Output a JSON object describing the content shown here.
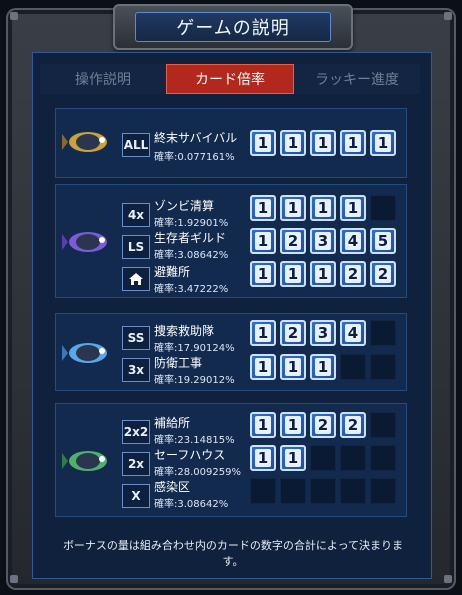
{
  "window": {
    "title": "ゲームの説明"
  },
  "tabs": [
    "操作説明",
    "カード倍率",
    "ラッキー進度"
  ],
  "active_tab": 1,
  "footer_text": "ボーナスの量は組み合わせ内のカードの数字の合計によって決まります。",
  "sections": [
    {
      "rows": [
        {
          "badge": "ALL",
          "name": "終末サバイバル",
          "prob": "確率:0.077161%",
          "cards": [
            "1",
            "1",
            "1",
            "1",
            "1"
          ]
        }
      ]
    },
    {
      "rows": [
        {
          "badge": "4x",
          "name": "ゾンビ清算",
          "prob": "確率:1.92901%",
          "cards": [
            "1",
            "1",
            "1",
            "1",
            ""
          ]
        },
        {
          "badge": "LS",
          "name": "生存者ギルド",
          "prob": "確率:3.08642%",
          "cards": [
            "1",
            "2",
            "3",
            "4",
            "5"
          ]
        },
        {
          "badge": "home-icon",
          "name": "避難所",
          "prob": "確率:3.47222%",
          "cards": [
            "1",
            "1",
            "1",
            "2",
            "2"
          ]
        }
      ]
    },
    {
      "rows": [
        {
          "badge": "SS",
          "name": "捜索救助隊",
          "prob": "確率:17.90124%",
          "cards": [
            "1",
            "2",
            "3",
            "4",
            ""
          ]
        },
        {
          "badge": "3x",
          "name": "防衛工事",
          "prob": "確率:19.29012%",
          "cards": [
            "1",
            "1",
            "1",
            "",
            ""
          ]
        }
      ]
    },
    {
      "rows": [
        {
          "badge": "2x2",
          "name": "補給所",
          "prob": "確率:23.14815%",
          "cards": [
            "1",
            "1",
            "2",
            "2",
            ""
          ]
        },
        {
          "badge": "2x",
          "name": "セーフハウス",
          "prob": "確率:28.009259%",
          "cards": [
            "1",
            "1",
            "",
            "",
            ""
          ]
        },
        {
          "badge": "X",
          "name": "感染区",
          "prob": "確率:3.08642%",
          "cards": [
            "",
            "",
            "",
            "",
            ""
          ]
        }
      ]
    }
  ],
  "colors": {
    "active_tab": "#b2281c",
    "panel": "#0f213d",
    "card": "#2f6fd0"
  }
}
